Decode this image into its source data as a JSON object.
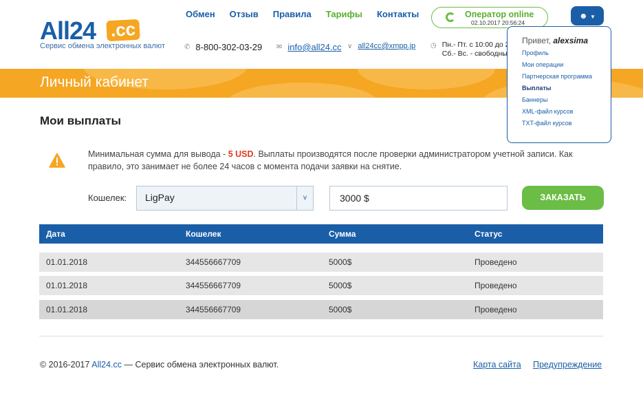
{
  "logo": {
    "brand": "All24",
    "badge": ".cc",
    "tagline": "Сервис обмена электронных валют"
  },
  "nav": {
    "items": [
      "Обмен",
      "Отзыв",
      "Правила",
      "Тарифы",
      "Контакты"
    ]
  },
  "contacts": {
    "phone": "8-800-302-03-29",
    "email": "info@all24.cc",
    "xmpp": "all24cc@xmpp.jp",
    "hours_line1": "Пн.- Пт. с 10:00 до 2",
    "hours_line2": "Сб.- Вс. - свободны"
  },
  "operator": {
    "title": "Оператор online",
    "datetime": "02.10.2017 20:56:24"
  },
  "user_menu": {
    "greeting": "Привет,",
    "username": "alexsima",
    "items": [
      "Профиль",
      "Мои операции",
      "Партнерская программа",
      "Выплаты",
      "Баннеры",
      "XML-файл курсов",
      "TXT-файл курсов"
    ],
    "active": "Выплаты"
  },
  "banner": {
    "title": "Личный кабинет"
  },
  "page": {
    "title": "Мои выплаты",
    "notice_pre": "Минимальная сумма для вывода - ",
    "notice_min": "5 USD",
    "notice_post": ". Выплаты производятся после проверки администратором учетной записи. Как правило, это занимает не более 24 часов с момента подачи заявки на снятие."
  },
  "form": {
    "wallet_label": "Кошелек:",
    "wallet_value": "LigPay",
    "amount_value": "3000 $",
    "submit_label": "ЗАКАЗАТЬ"
  },
  "table": {
    "headers": [
      "Дата",
      "Кошелек",
      "Сумма",
      "Статус"
    ],
    "rows": [
      [
        "01.01.2018",
        "344556667709",
        "5000$",
        "Проведено"
      ],
      [
        "01.01.2018",
        "344556667709",
        "5000$",
        "Проведено"
      ],
      [
        "01.01.2018",
        "344556667709",
        "5000$",
        "Проведено"
      ]
    ]
  },
  "footer": {
    "copyright_pre": "© 2016-2017 ",
    "copyright_link": "All24.cc",
    "copyright_post": " — Сервис обмена электронных валют.",
    "sitemap": "Карта сайта",
    "warning": "Предупреждение"
  },
  "colors": {
    "primary": "#1a5ea8",
    "green": "#6bbd45",
    "banner": "#f5a623",
    "alert": "#e03a1e"
  }
}
